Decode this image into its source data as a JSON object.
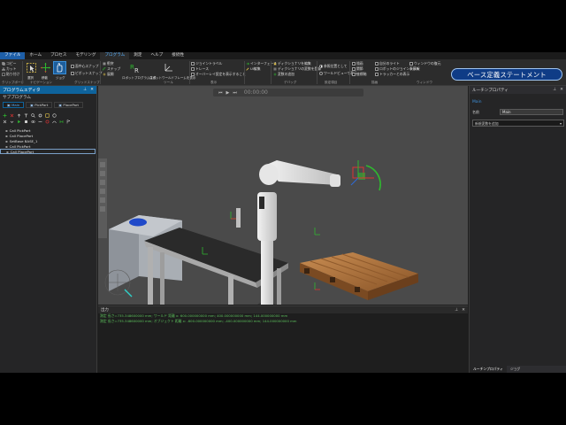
{
  "menu": {
    "tabs": [
      {
        "label": "ファイル",
        "state": "file"
      },
      {
        "label": "ホーム",
        "state": ""
      },
      {
        "label": "プロセス",
        "state": ""
      },
      {
        "label": "モデリング",
        "state": ""
      },
      {
        "label": "プログラム",
        "state": "active"
      },
      {
        "label": "測定",
        "state": ""
      },
      {
        "label": "ヘルプ",
        "state": ""
      },
      {
        "label": "接続性",
        "state": ""
      }
    ]
  },
  "ribbon": {
    "clipboard": {
      "copy": "コピー",
      "cut": "カット",
      "paste": "貼り付け",
      "label": "クリップボード"
    },
    "navigation": {
      "select": "選択",
      "move": "移動",
      "jog": "ジョグ",
      "label": "ナビゲーション"
    },
    "snap": {
      "face_center": "面中心スナップ",
      "pivot": "ピボットスナップ",
      "label": "グリッドスナップ"
    },
    "tools": {
      "collision": "衝突",
      "step": "ステップ",
      "expand": "展開",
      "robot_gen": "ロボットプログラム生成",
      "robot_world": "ロボットワールドフレームを表示",
      "label": "ツール"
    },
    "display": {
      "show_points": "ジョイントラベル",
      "trace": "トレース",
      "overlay": "オーバーレイ設定を表示すること",
      "label": "表示"
    },
    "interface": {
      "interface": "インターフェース",
      "edit_ui": "UI編集",
      "label": "インターフェース"
    },
    "debug": {
      "connect_device": "ディクショナリを編集",
      "simulation": "ディクショナリの変数を登録",
      "variables": "変数の追加",
      "label": "デバッグ"
    },
    "settings": {
      "with_reference": "参照位置として",
      "world_view": "ワールドビューで表示",
      "label": "設定項目"
    },
    "render": {
      "line": "描画",
      "joint": "関節",
      "frame": "座標軸",
      "visible": "可視化",
      "label": "描画"
    },
    "show_hide": {
      "joint_lights": "自分のライト",
      "robot_joint_info": "ロボットのジョイント情報",
      "tracker": "トラッカーとの表示",
      "label": "表示/非表示"
    },
    "windows": {
      "window_restore": "ウィンドウの復元",
      "display": "表示",
      "label": "ウィンドウ"
    }
  },
  "banner": {
    "text": "ベース定義ステートメント"
  },
  "left_panel": {
    "title": "プログラムエディタ",
    "subtitle": "サブプログラム",
    "tabs": [
      "Main",
      "PickPart",
      "PlacePart"
    ],
    "program_lines": [
      {
        "text": "Call PickPart",
        "selected": false
      },
      {
        "text": "Call PlacePart",
        "selected": false
      },
      {
        "text": "SetBase BASE_1",
        "selected": false
      },
      {
        "text": "Call PickPart",
        "selected": false
      },
      {
        "text": "Call PlacePart",
        "selected": true
      }
    ]
  },
  "viewport": {
    "time": "00:00:00"
  },
  "output": {
    "title": "出力",
    "lines": [
      "測定 長さ=735.348600000 mm; ワールド 距離 x: 600.000000000 mm; 400.000000000 mm; 144.000000000 mm",
      "測定 長さ=735.348600000 mm; オブジェクト 距離 x: -600.000000000 mm; -400.000000000 mm; 144.000000000 mm"
    ]
  },
  "right_panel": {
    "title": "ルーチンプロパティ",
    "routine_link": "Main",
    "name_label": "名前",
    "name_value": "Main",
    "dropdown": "新規変数を追加",
    "bottom_tabs": [
      "ルーチンプロパティ",
      "ジョグ"
    ]
  },
  "colors": {
    "accent": "#0e639c",
    "banner_bg": "#0f3c86",
    "output_text": "#5cc05c",
    "viewport_bg": "#4a4a4a"
  }
}
